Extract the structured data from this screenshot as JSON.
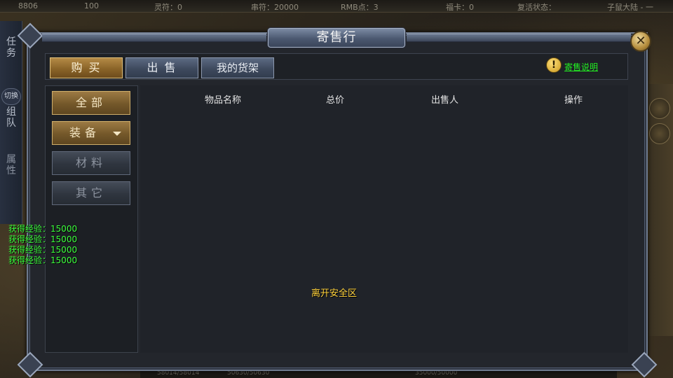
{
  "topbar": {
    "items": [
      "8806",
      "100",
      "灵符：0",
      "串符：20000",
      "RMB点：3",
      "福卡：0",
      "复活状态：",
      "子鼠大陆 - 一"
    ]
  },
  "bottombar": {
    "items": [
      "58014/58014",
      "50630/50630",
      "35000/50000"
    ]
  },
  "left_strip": {
    "task": "任务",
    "switch": "切换",
    "team": "组队",
    "attr": "属性"
  },
  "window": {
    "title": "寄售行",
    "close": "✕"
  },
  "tabs": [
    {
      "label": "购 买",
      "active": true
    },
    {
      "label": "出 售",
      "active": false
    },
    {
      "label": "我的货架",
      "active": false
    }
  ],
  "help": {
    "icon": "!",
    "label": "寄售说明"
  },
  "categories": [
    {
      "label": "全部",
      "active": true
    },
    {
      "label": "装备",
      "active": true
    },
    {
      "label": "材料",
      "active": false
    },
    {
      "label": "其它",
      "active": false
    }
  ],
  "table": {
    "headers": [
      "物品名称",
      "总价",
      "出售人",
      "操作"
    ]
  },
  "exp_messages": [
    "获得经验：15000",
    "获得经验：15000",
    "获得经验：15000",
    "获得经验：15000"
  ],
  "notice": "离开安全区",
  "colors": {
    "accent_gold": "#b48a46",
    "tab_blue": "#3e4a5e",
    "exp_green": "#3cff3c",
    "notice_yellow": "#ffd23c",
    "link_green": "#22ee22"
  }
}
